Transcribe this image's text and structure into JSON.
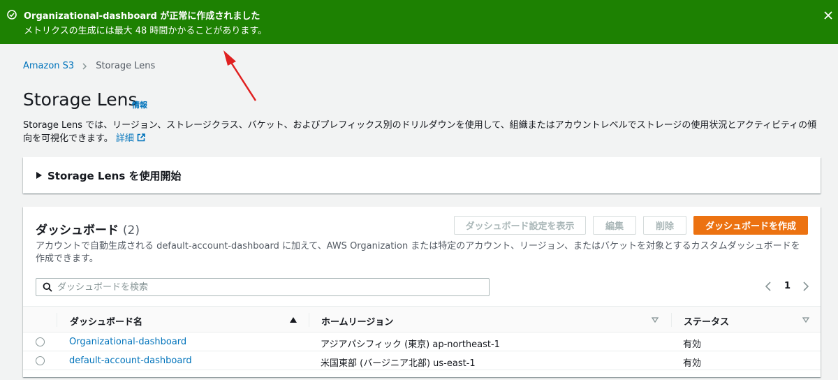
{
  "flash": {
    "title": "Organizational-dashboard が正常に作成されました",
    "message": "メトリクスの生成には最大 48 時間かかることがあります。"
  },
  "breadcrumb": {
    "root": "Amazon S3",
    "current": "Storage Lens"
  },
  "page": {
    "title": "Storage Lens",
    "info": "情報",
    "description": "Storage Lens では、リージョン、ストレージクラス、バケット、およびプレフィックス別のドリルダウンを使用して、組織またはアカウントレベルでストレージの使用状況とアクティビティの傾向を可視化できます。",
    "learn_more": "詳細"
  },
  "getting_started": {
    "title": "Storage Lens を使用開始"
  },
  "dashboards": {
    "title": "ダッシュボード",
    "count": "(2)",
    "view_settings_label": "ダッシュボード設定を表示",
    "edit_label": "編集",
    "delete_label": "削除",
    "create_label": "ダッシュボードを作成",
    "description": "アカウントで自動生成される default-account-dashboard に加えて、AWS Organization または特定のアカウント、リージョン、またはバケットを対象とするカスタムダッシュボードを作成できます。",
    "search_placeholder": "ダッシュボードを検索",
    "page_number": "1",
    "columns": [
      "ダッシュボード名",
      "ホームリージョン",
      "ステータス"
    ],
    "rows": [
      {
        "name": "Organizational-dashboard",
        "region": "アジアパシフィック (東京) ap-northeast-1",
        "status": "有効"
      },
      {
        "name": "default-account-dashboard",
        "region": "米国東部 (バージニア北部) us-east-1",
        "status": "有効"
      }
    ]
  },
  "colors": {
    "success": "#1d8102",
    "link": "#0073bb",
    "primary": "#ec7211",
    "annotation": "#e02020"
  }
}
